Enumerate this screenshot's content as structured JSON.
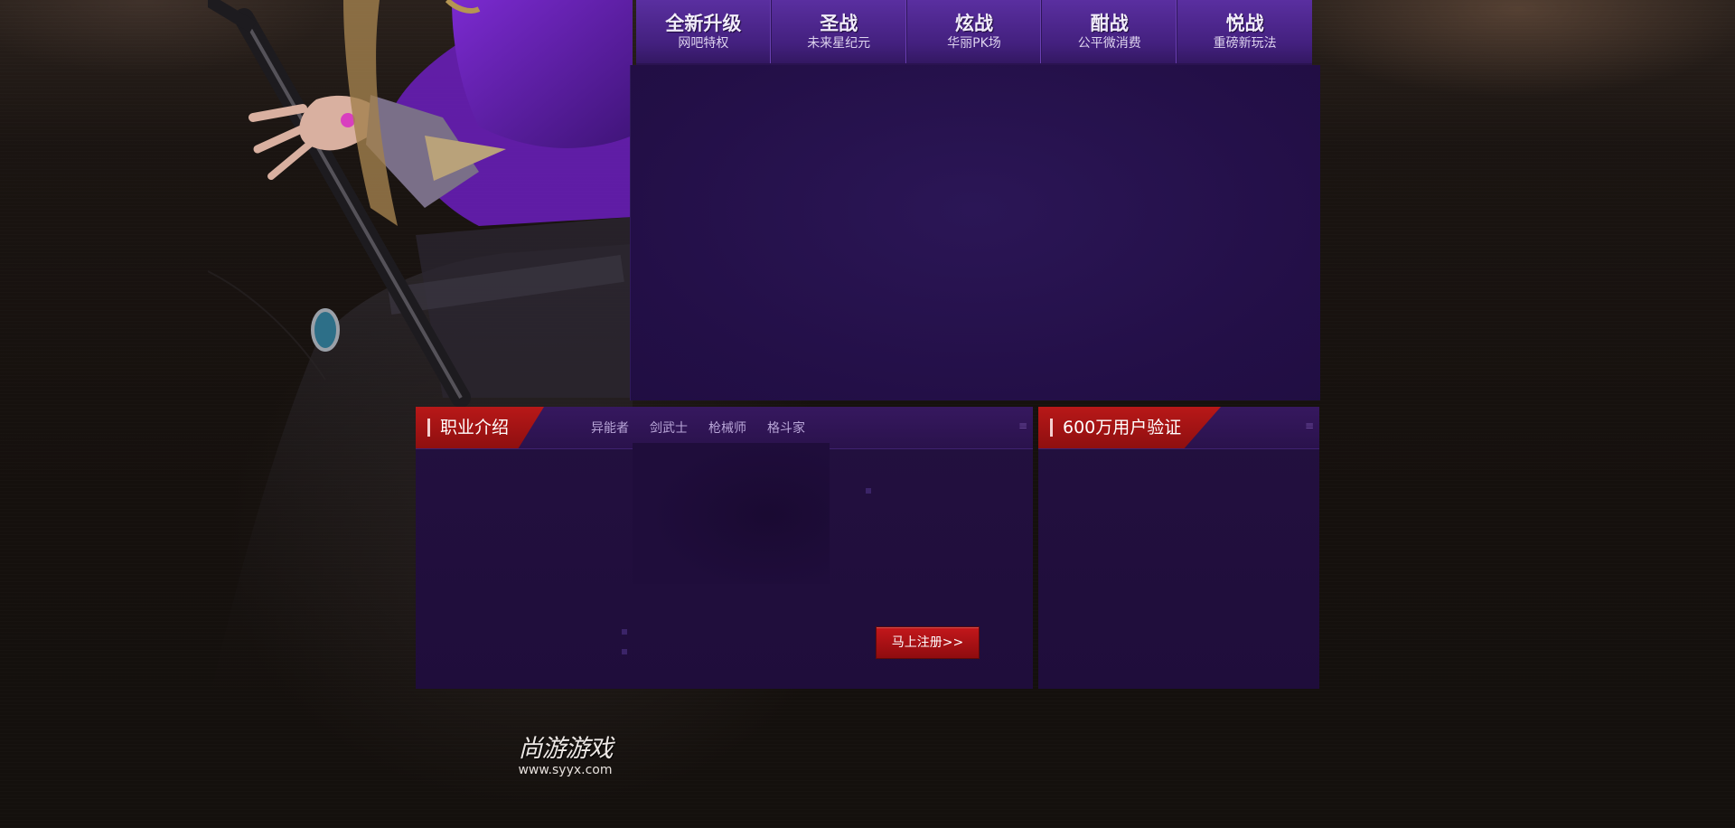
{
  "top_nav": {
    "items": [
      {
        "title": "全新升级",
        "sub": "网吧特权"
      },
      {
        "title": "圣战",
        "sub": "未来星纪元"
      },
      {
        "title": "炫战",
        "sub": "华丽PK场"
      },
      {
        "title": "酣战",
        "sub": "公平微消费"
      },
      {
        "title": "悦战",
        "sub": "重磅新玩法"
      }
    ]
  },
  "career_panel": {
    "title": "职业介绍",
    "tabs": [
      "异能者",
      "剑武士",
      "枪械师",
      "格斗家"
    ],
    "register_label": "马上注册>>"
  },
  "users_panel": {
    "title": "600万用户验证"
  },
  "footer_logo": {
    "name": "尚游游戏",
    "url": "www.syyx.com"
  },
  "colors": {
    "nav_purple": "#4a2388",
    "panel_purple": "#21103d",
    "accent_red": "#b81818",
    "page_bg": "#16110e"
  }
}
